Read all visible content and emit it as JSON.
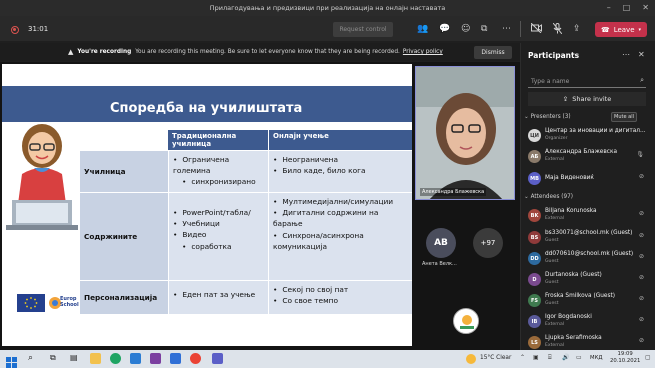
{
  "window": {
    "title": "Прилагодувања и предизвици при реализација на онлајн наставата"
  },
  "toolbar": {
    "timer": "31:01",
    "request_control": "Request control",
    "leave_label": "Leave"
  },
  "banner": {
    "strong": "You're recording",
    "text": "You are recording this meeting. Be sure to let everyone know that they are being recorded.",
    "link": "Privacy policy",
    "dismiss": "Dismiss"
  },
  "slide": {
    "title": "Споредба на училиштата",
    "headers": [
      "",
      "Традиционална училница",
      "Онлајн учење"
    ],
    "rows": [
      {
        "label": "Училница",
        "col1": [
          "Ограничена големина",
          "синхронизирано"
        ],
        "col2": [
          "Неограничена",
          "Било каде, било кога"
        ]
      },
      {
        "label": "Содржините",
        "col1": [
          "PowerPoint/табла/",
          "Учебници",
          "Видео",
          "соработка"
        ],
        "col2": [
          "Мултимедијални/симулации",
          "Дигитални содржини на барање",
          "Синхрона/асинхрона комуникација"
        ]
      },
      {
        "label": "Персонализација",
        "col1": [
          "Еден пат за учење"
        ],
        "col2": [
          "Секој по свој пат",
          "Со свое темпо"
        ]
      }
    ],
    "logo_text": "Europ School"
  },
  "stage": {
    "presenter_name": "Александра Блажевска",
    "video_name": "Александра Блажевска",
    "ab_initials": "AB",
    "ab_name": "Анета Велк...",
    "more_count": "+97"
  },
  "participants": {
    "title": "Participants",
    "search_placeholder": "Type a name",
    "share_invite": "Share invite",
    "presenters_header": "Presenters (3)",
    "mute_all": "Mute all",
    "attendees_header": "Attendees (97)",
    "presenters": [
      {
        "name": "Центар за иновации и дигитал...",
        "sub": "Organizer",
        "initials": "ЦИ",
        "color": "#d9d9d9"
      },
      {
        "name": "Александра Блажевска",
        "sub": "External",
        "initials": "АБ",
        "color": "#8a7a6a"
      },
      {
        "name": "Маја Виденовиќ",
        "sub": "",
        "initials": "МВ",
        "color": "#5b5fc7"
      }
    ],
    "attendees": [
      {
        "name": "Biljana Korunoska",
        "sub": "External",
        "initials": "BK",
        "color": "#a0463c"
      },
      {
        "name": "bs330071@school.mk (Guest)",
        "sub": "Guest",
        "initials": "BS",
        "color": "#8f3a3a"
      },
      {
        "name": "dd070610@school.mk (Guest)",
        "sub": "Guest",
        "initials": "DD",
        "color": "#2d6a9f"
      },
      {
        "name": "Durtanoska (Guest)",
        "sub": "Guest",
        "initials": "D",
        "color": "#7a4a8f"
      },
      {
        "name": "Froska Smilkova (Guest)",
        "sub": "Guest",
        "initials": "FS",
        "color": "#3f7a4f"
      },
      {
        "name": "Igor Bogdanoski",
        "sub": "External",
        "initials": "IB",
        "color": "#5a5a9a"
      },
      {
        "name": "Ljupka Serafimoska",
        "sub": "External",
        "initials": "LS",
        "color": "#9a6a3a"
      }
    ]
  },
  "taskbar": {
    "weather": "15°C  Clear",
    "lang": "МКД",
    "time": "19:09",
    "date": "20.10.2021"
  },
  "colors": {
    "slide_blue": "#3d5a8f",
    "leave_red": "#c4314b",
    "accent": "#8a8fd6"
  }
}
